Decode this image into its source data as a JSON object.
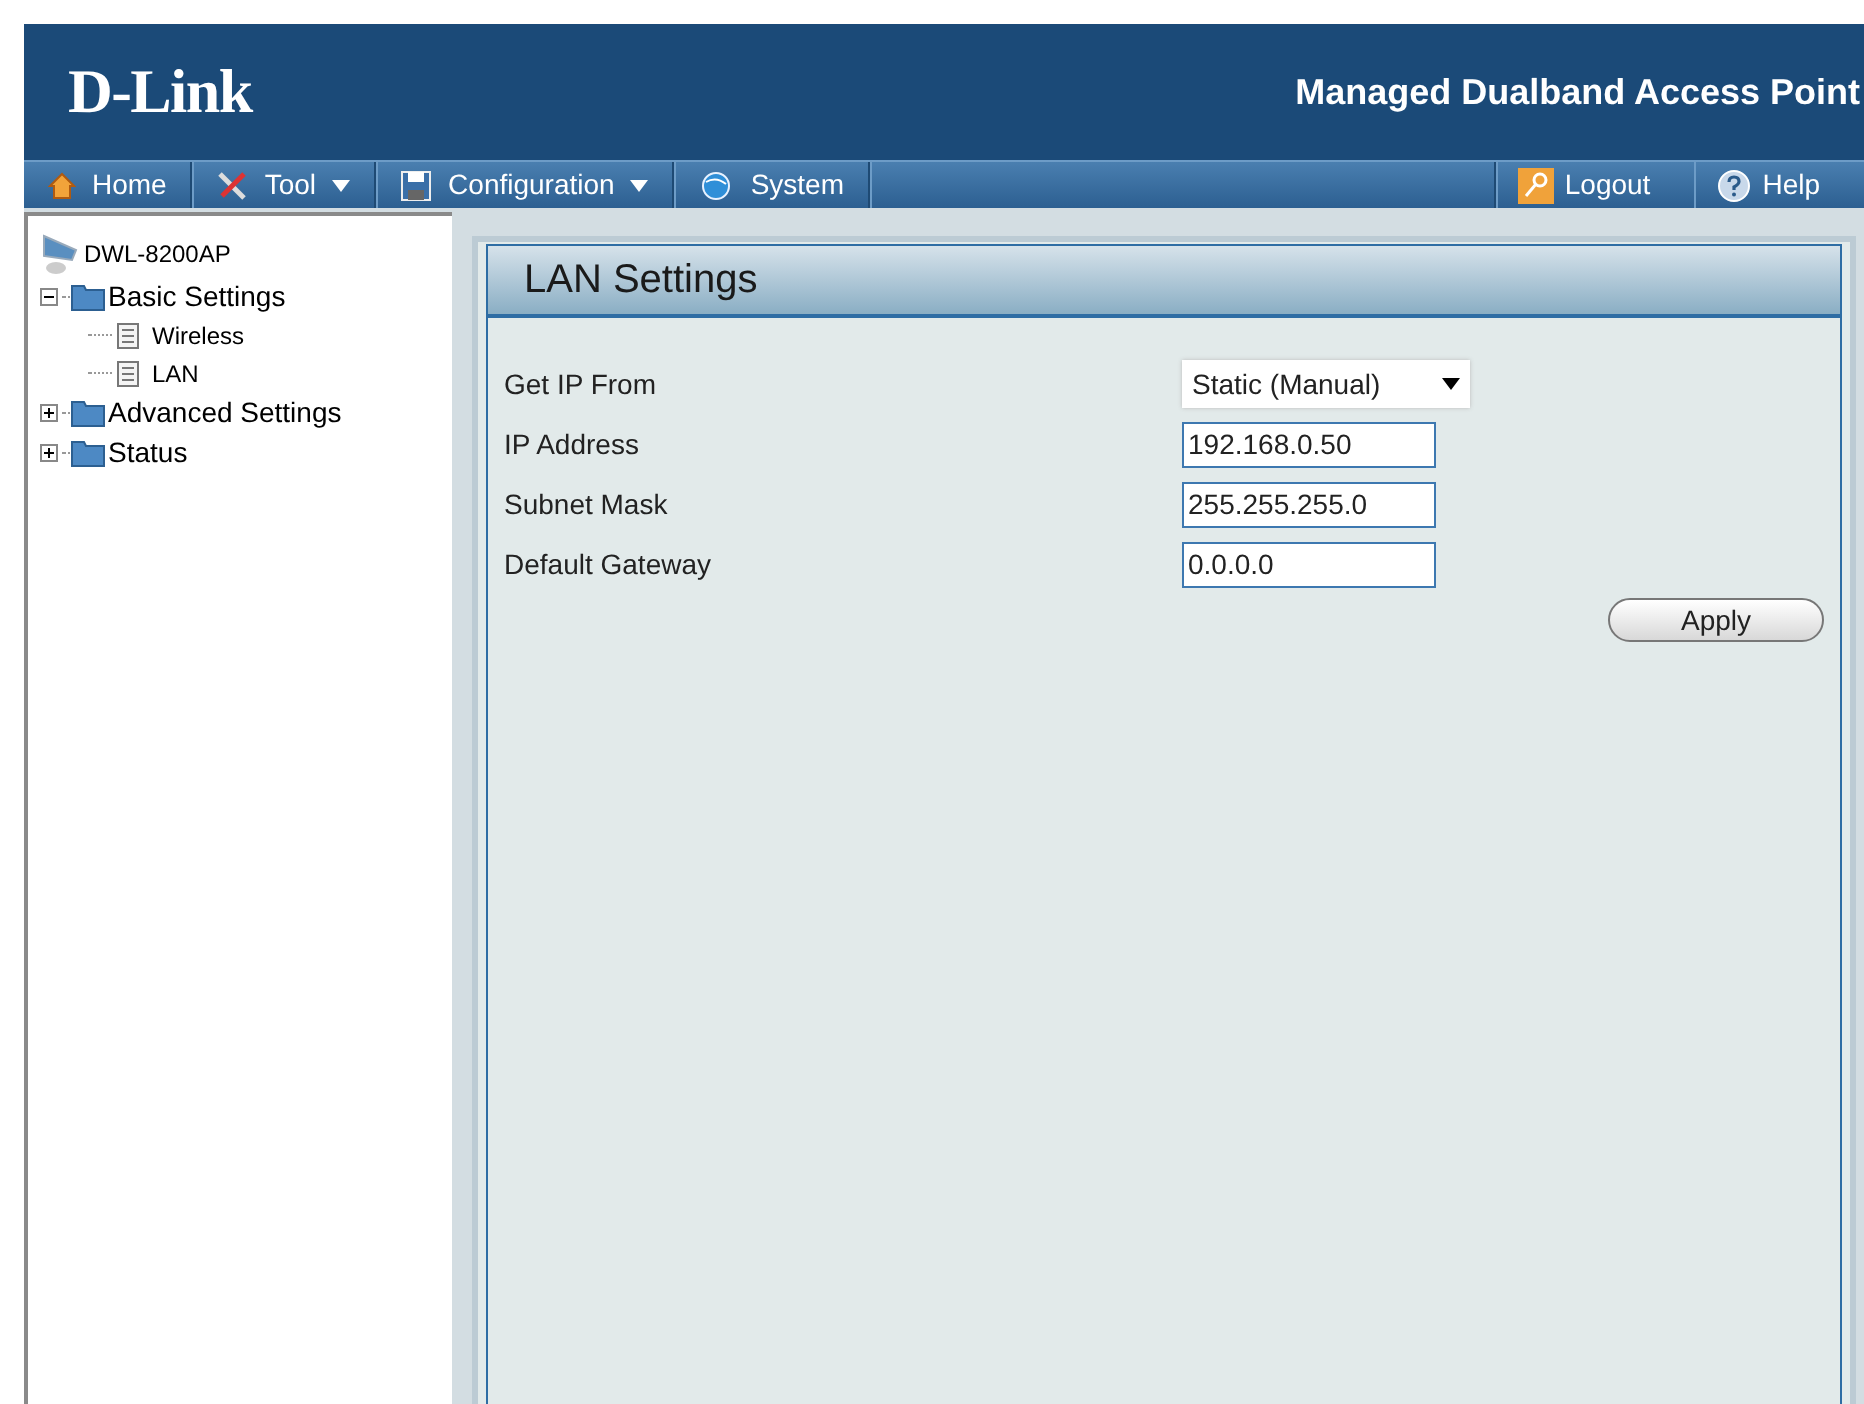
{
  "header": {
    "logo": "D-Link",
    "title": "Managed Dualband Access Point"
  },
  "menu": [
    {
      "label": "Home",
      "dropdown": false
    },
    {
      "label": "Tool",
      "dropdown": true
    },
    {
      "label": "Configuration",
      "dropdown": true
    },
    {
      "label": "System",
      "dropdown": false
    }
  ],
  "menu_right": [
    {
      "label": "Logout"
    },
    {
      "label": "Help"
    }
  ],
  "tree": {
    "label": "DWL-8200AP",
    "children": [
      {
        "label": "Basic Settings",
        "kind": "folder",
        "expanded": true,
        "children": [
          {
            "label": "Wireless",
            "kind": "page"
          },
          {
            "label": "LAN",
            "kind": "page"
          }
        ]
      },
      {
        "label": "Advanced Settings",
        "kind": "folder",
        "expanded": false
      },
      {
        "label": "Status",
        "kind": "folder",
        "expanded": false
      }
    ]
  },
  "panel": {
    "title": "LAN Settings",
    "fields": [
      {
        "label": "Get IP From",
        "kind": "select",
        "value": "Static (Manual)"
      },
      {
        "label": "IP Address",
        "kind": "text",
        "value": "192.168.0.50"
      },
      {
        "label": "Subnet Mask",
        "kind": "text",
        "value": "255.255.255.0"
      },
      {
        "label": "Default Gateway",
        "kind": "text",
        "value": "0.0.0.0"
      }
    ],
    "button": "Apply"
  }
}
